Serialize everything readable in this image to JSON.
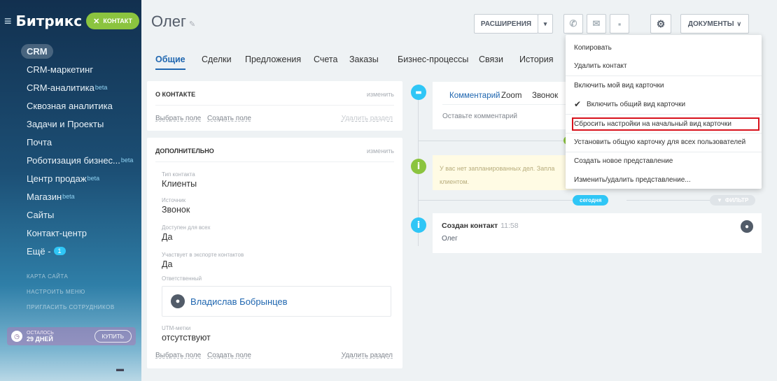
{
  "sidebar": {
    "logo": "Битрикс",
    "badge": "контакт",
    "badge_close": "✕",
    "items": [
      {
        "label": "CRM",
        "beta": ""
      },
      {
        "label": "CRM-маркетинг",
        "beta": ""
      },
      {
        "label": "CRM-аналитика",
        "beta": "beta"
      },
      {
        "label": "Сквозная аналитика",
        "beta": ""
      },
      {
        "label": "Задачи и Проекты",
        "beta": ""
      },
      {
        "label": "Почта",
        "beta": ""
      },
      {
        "label": "Роботизация бизнес...",
        "beta": "beta"
      },
      {
        "label": "Центр продаж",
        "beta": "beta"
      },
      {
        "label": "Магазин",
        "beta": "beta"
      },
      {
        "label": "Сайты",
        "beta": ""
      },
      {
        "label": "Контакт-центр",
        "beta": ""
      }
    ],
    "more_label": "Ещё -",
    "more_count": "1",
    "small_links": [
      "КАРТА САЙТА",
      "НАСТРОИТЬ МЕНЮ",
      "ПРИГЛАСИТЬ СОТРУДНИКОВ"
    ],
    "trial": {
      "line1": "осталось",
      "line2": "29 ДНЕЙ",
      "button": "КУПИТЬ"
    }
  },
  "header": {
    "title": "Олег",
    "extensions_btn": "РАСШИРЕНИЯ",
    "documents_btn": "ДОКУМЕНТЫ"
  },
  "tabs": [
    "Общие",
    "Сделки",
    "Предложения",
    "Счета",
    "Заказы",
    "Бизнес-процессы",
    "Связи",
    "История"
  ],
  "about": {
    "title": "О КОНТАКТЕ",
    "edit": "изменить",
    "select_field": "Выбрать поле",
    "create_field": "Создать поле",
    "delete_section": "Удалить раздел"
  },
  "additional": {
    "title": "ДОПОЛНИТЕЛЬНО",
    "edit": "изменить",
    "fields": [
      {
        "label": "Тип контакта",
        "value": "Клиенты"
      },
      {
        "label": "Источник",
        "value": "Звонок"
      },
      {
        "label": "Доступен для всех",
        "value": "Да"
      },
      {
        "label": "Участвует в экспорте контактов",
        "value": "Да"
      }
    ],
    "responsible_label": "Ответственный",
    "responsible_name": "Владислав Бобрынцев",
    "utm_label": "UTM-метки",
    "utm_value": "отсутствуют",
    "select_field": "Выбрать поле",
    "create_field": "Создать поле",
    "delete_section": "Удалить раздел"
  },
  "timeline": {
    "comment_tabs": [
      "Комментарий",
      "Zoom",
      "Звонок"
    ],
    "comment_placeholder": "Оставьте комментарий",
    "plan_text": "У вас нет запланированных дел. Запла клиентом.",
    "today": "сегодня",
    "filter": "ФИЛЬТР",
    "event_title": "Создан контакт",
    "event_time": "11:58",
    "event_sub": "Олег"
  },
  "menu": {
    "items": [
      "Копировать",
      "Удалить контакт",
      "Включить мой вид карточки",
      "Включить общий вид карточки",
      "Сбросить настройки на начальный вид карточки",
      "Установить общую карточку для всех пользователей",
      "Создать новое представление",
      "Изменить/удалить представление..."
    ],
    "checked_index": 3,
    "highlighted_index": 4
  },
  "colors": {
    "accent": "#2067b0",
    "badge_green": "#8bc43f",
    "highlight_red": "#d8121c",
    "timeline_blue": "#2fc6f6",
    "timeline_green": "#8bc43f"
  }
}
